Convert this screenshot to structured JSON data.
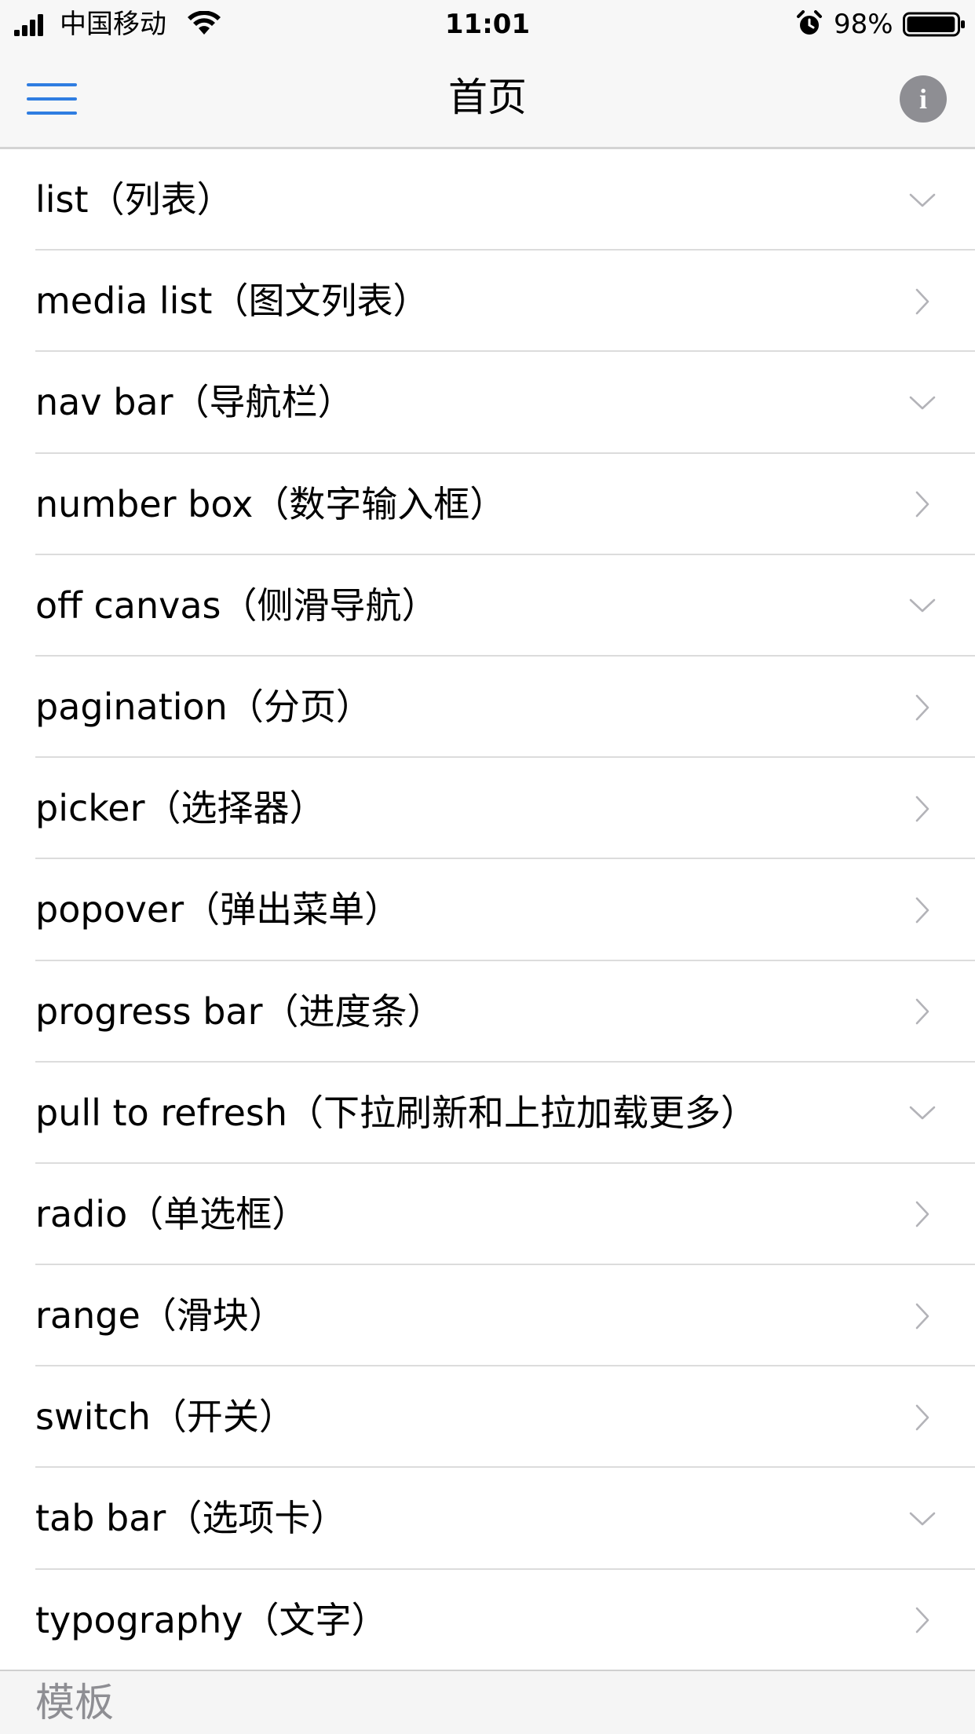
{
  "status_bar": {
    "carrier": "中国移动",
    "time": "11:01",
    "battery_percent": "98%",
    "battery_level": 0.98,
    "icons": [
      "signal-icon",
      "wifi-icon",
      "alarm-icon",
      "battery-icon"
    ]
  },
  "nav": {
    "title": "首页",
    "menu_icon": "hamburger-menu-icon",
    "info_icon": "info-icon",
    "info_glyph": "i",
    "accent_color": "#2f7de1",
    "info_color": "#8e8e93"
  },
  "list": {
    "items": [
      {
        "label": "list（列表）",
        "indicator": "chevron-down"
      },
      {
        "label": "media list（图文列表）",
        "indicator": "chevron-right"
      },
      {
        "label": "nav bar（导航栏）",
        "indicator": "chevron-down"
      },
      {
        "label": "number box（数字输入框）",
        "indicator": "chevron-right"
      },
      {
        "label": "off canvas（侧滑导航）",
        "indicator": "chevron-down"
      },
      {
        "label": "pagination（分页）",
        "indicator": "chevron-right"
      },
      {
        "label": "picker（选择器）",
        "indicator": "chevron-right"
      },
      {
        "label": "popover（弹出菜单）",
        "indicator": "chevron-right"
      },
      {
        "label": "progress bar（进度条）",
        "indicator": "chevron-right"
      },
      {
        "label": "pull to refresh（下拉刷新和上拉加载更多）",
        "indicator": "chevron-down"
      },
      {
        "label": "radio（单选框）",
        "indicator": "chevron-right"
      },
      {
        "label": "range（滑块）",
        "indicator": "chevron-right"
      },
      {
        "label": "switch（开关）",
        "indicator": "chevron-right"
      },
      {
        "label": "tab bar（选项卡）",
        "indicator": "chevron-down"
      },
      {
        "label": "typography（文字）",
        "indicator": "chevron-right"
      }
    ]
  },
  "section": {
    "title": "模板"
  }
}
